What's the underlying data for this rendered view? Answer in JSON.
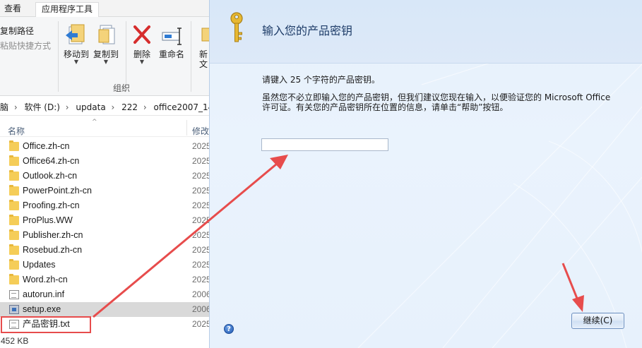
{
  "explorer": {
    "tabs": {
      "view": "查看",
      "app_tools": "应用程序工具"
    },
    "clipboard": {
      "copy_path": "复制路径",
      "paste_shortcut": "粘贴快捷方式"
    },
    "ribbon": {
      "move_to": "移动到",
      "copy_to": "复制到",
      "delete": "删除",
      "rename": "重命名",
      "new_partial": "新",
      "new_partial2": "文",
      "group_label": "组织"
    },
    "address": [
      "脑",
      "软件 (D:)",
      "updata",
      "222",
      "office2007_14"
    ],
    "columns": {
      "name": "名称",
      "modified": "修改"
    },
    "files": [
      {
        "name": "Office.zh-cn",
        "date": "2025",
        "type": "folder"
      },
      {
        "name": "Office64.zh-cn",
        "date": "2025",
        "type": "folder"
      },
      {
        "name": "Outlook.zh-cn",
        "date": "2025",
        "type": "folder"
      },
      {
        "name": "PowerPoint.zh-cn",
        "date": "2025",
        "type": "folder"
      },
      {
        "name": "Proofing.zh-cn",
        "date": "2025",
        "type": "folder"
      },
      {
        "name": "ProPlus.WW",
        "date": "2025",
        "type": "folder"
      },
      {
        "name": "Publisher.zh-cn",
        "date": "2025",
        "type": "folder"
      },
      {
        "name": "Rosebud.zh-cn",
        "date": "2025",
        "type": "folder"
      },
      {
        "name": "Updates",
        "date": "2025",
        "type": "folder"
      },
      {
        "name": "Word.zh-cn",
        "date": "2025",
        "type": "folder"
      },
      {
        "name": "autorun.inf",
        "date": "2006",
        "type": "inf"
      },
      {
        "name": "setup.exe",
        "date": "2006",
        "type": "exe"
      },
      {
        "name": "产品密钥.txt",
        "date": "2025",
        "type": "txt"
      }
    ],
    "status": "452 KB"
  },
  "dialog": {
    "title": "输入您的产品密钥",
    "instruction": "请键入 25 个字符的产品密钥。",
    "description": "虽然您不必立即输入您的产品密钥，但我们建议您现在输入，以便验证您的 Microsoft Office 许可证。有关您的产品密钥所在位置的信息，请单击“帮助”按钮。",
    "key_value": "",
    "help_label": "?",
    "continue_label": "继续(C)"
  },
  "colors": {
    "annotation": "#e74c4c",
    "dialog_bg": "#e8f1fc",
    "title_text": "#1e3c68"
  }
}
